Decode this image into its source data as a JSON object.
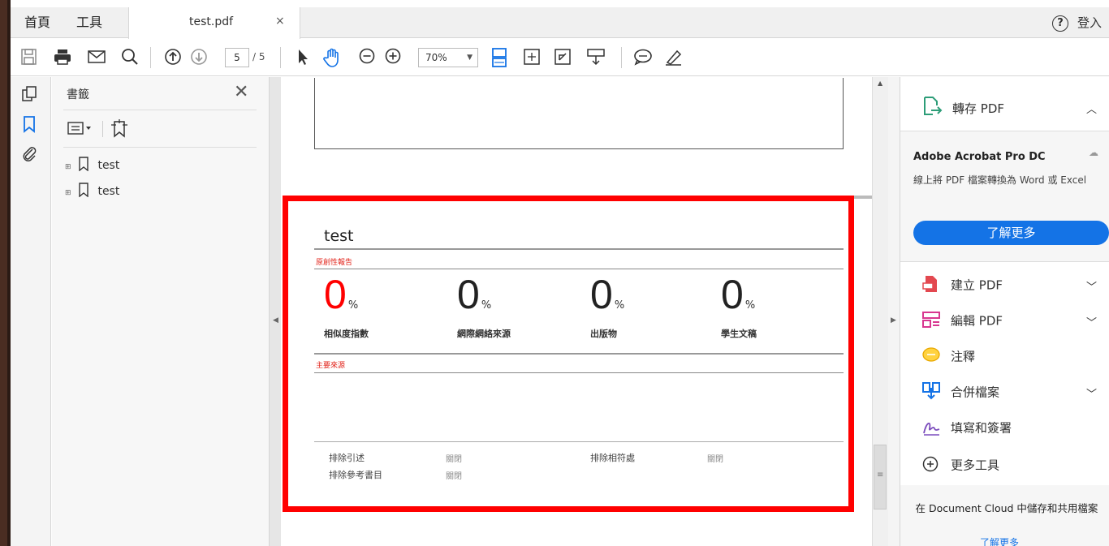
{
  "tabs": {
    "home": "首頁",
    "tools": "工具",
    "document": "test.pdf",
    "close": "×",
    "help": "?",
    "login": "登入"
  },
  "toolbar": {
    "current_page": "5",
    "total_pages": "/ 5",
    "zoom": "70%"
  },
  "bookmarks": {
    "title": "書籤",
    "items": [
      "test",
      "test"
    ]
  },
  "report": {
    "title": "test",
    "originality_section": "原創性報告",
    "metrics": [
      {
        "value": "0",
        "unit": "%",
        "label": "相似度指數"
      },
      {
        "value": "0",
        "unit": "%",
        "label": "網際網絡來源"
      },
      {
        "value": "0",
        "unit": "%",
        "label": "出版物"
      },
      {
        "value": "0",
        "unit": "%",
        "label": "學生文稿"
      }
    ],
    "sources_section": "主要來源",
    "filters": {
      "exclude_quotes": "排除引述",
      "exclude_quotes_value": "關閉",
      "exclude_matches": "排除相符處",
      "exclude_matches_value": "關閉",
      "exclude_bibliography": "排除參考書目",
      "exclude_bibliography_value": "關閉"
    }
  },
  "right_panel": {
    "export_title": "轉存 PDF",
    "promo_title": "Adobe Acrobat Pro DC",
    "promo_desc": "線上將 PDF 檔案轉換為 Word 或 Excel",
    "promo_button": "了解更多",
    "tools": [
      "建立 PDF",
      "編輯 PDF",
      "注釋",
      "合併檔案",
      "填寫和簽署",
      "更多工具"
    ],
    "cloud_text": "在 Document Cloud 中儲存和共用檔案",
    "cloud_link": "了解更多"
  },
  "colors": {
    "accent": "#1473e6",
    "highlight_box": "#ff0000",
    "similarity": "#ff0000"
  }
}
